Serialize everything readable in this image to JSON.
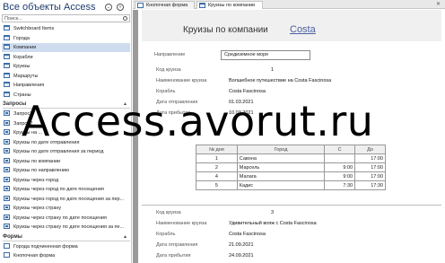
{
  "nav": {
    "title": "Все объекты Access",
    "search_placeholder": "Поиск...",
    "tables": [
      "Switchboard Items",
      "Города",
      "Компании",
      "Корабли",
      "Круизы",
      "Маршруты",
      "Направления",
      "Страны"
    ],
    "queries_group": "Запросы",
    "queries": [
      "Запрос1",
      "Запрос2",
      "Круизы на ...",
      "Круизы по дате отправления",
      "Круизы по дате отправления за период",
      "Круизы по компании",
      "Круизы по направлению",
      "Круизы через город",
      "Круизы через город по дате посещения",
      "Круизы через город по дате посещения за пер...",
      "Круизы через страну",
      "Круизы через страну по дате посещения",
      "Круизы через страну по дате посещения за пе..."
    ],
    "forms_group": "Формы",
    "forms": [
      "Города подчиненная форма",
      "Кнопочная форма"
    ],
    "selected": "Компании"
  },
  "tabs": [
    {
      "label": "Кнопочная форма"
    },
    {
      "label": "Круизы по компании"
    }
  ],
  "report": {
    "title": "Круизы по компании",
    "company": "Costa",
    "direction_label": "Направление",
    "direction_value": "Средиземное море",
    "labels": {
      "cruise_code": "Код круиза",
      "cruise_name": "Наименование круиза",
      "ship": "Корабль",
      "departure": "Дата отправления",
      "arrival": "Дата прибытия"
    },
    "cruise1": {
      "code": "1",
      "name": "Волшебное путешествие на Costa Fascinosa",
      "ship": "Costa Fascinosa",
      "departure": "01.03.2021",
      "arrival": "10.03.2021"
    },
    "grid_headers": [
      "№ дня",
      "Город",
      "С",
      "До"
    ],
    "grid_rows": [
      {
        "day": "1",
        "city": "Савона",
        "from": "",
        "to": "17:00"
      },
      {
        "day": "2",
        "city": "Марсель",
        "from": "9:00",
        "to": "17:00"
      },
      {
        "day": "4",
        "city": "Малага",
        "from": "9:00",
        "to": "17:00"
      },
      {
        "day": "5",
        "city": "Кадис",
        "from": "7:30",
        "to": "17:30"
      }
    ],
    "cruise2": {
      "code": "3",
      "name": "Удивительный вояж с Costa Fascinosa",
      "ship": "Costa Fascinosa",
      "departure": "21.09.2021",
      "arrival": "24.09.2021"
    }
  },
  "watermark": "Access.avorut.ru",
  "colors": {
    "accent": "#4a5fa0",
    "selection": "#cfdcef"
  }
}
